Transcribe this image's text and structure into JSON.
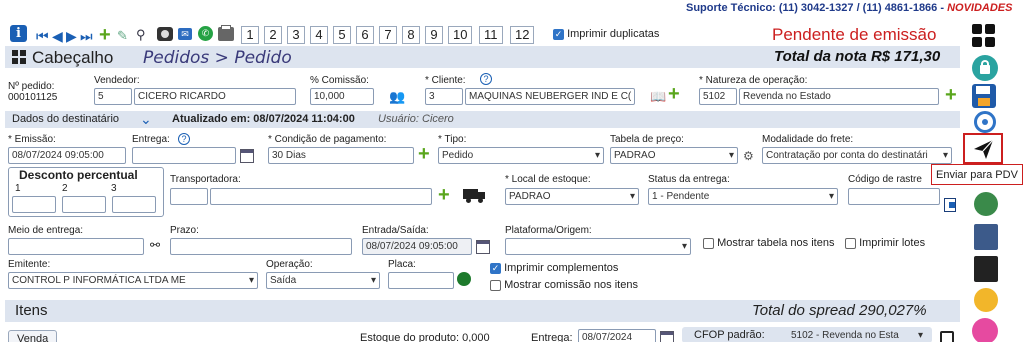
{
  "support": {
    "text": "Suporte Técnico: (11) 3042-1327 / (11) 4861-1866 - ",
    "novidades": "NOVIDADES"
  },
  "toolbar": {
    "pages": [
      "1",
      "2",
      "3",
      "4",
      "5",
      "6",
      "7",
      "8",
      "9",
      "10",
      "11",
      "12"
    ],
    "print_duplicates_label": "Imprimir duplicatas",
    "print_duplicates_checked": true
  },
  "status": "Pendente de emissão",
  "header": {
    "title": "Cabeçalho",
    "breadcrumb": "Pedidos > Pedido",
    "total": "Total da nota R$ 171,30"
  },
  "order": {
    "numero_label": "Nº pedido:",
    "numero_value": "000101125",
    "vendedor_label": "Vendedor:",
    "vendedor_code": "5",
    "vendedor_name": "CICERO RICARDO",
    "comissao_label": "% Comissão:",
    "comissao_value": "10,000",
    "cliente_label": "* Cliente:",
    "cliente_code": "3",
    "cliente_name": "MAQUINAS NEUBERGER IND E C(",
    "natureza_label": "* Natureza de operação:",
    "natureza_code": "5102",
    "natureza_name": "Revenda no Estado"
  },
  "destinatario": {
    "label": "Dados do destinatário",
    "updated": "Atualizado em: 08/07/2024 11:04:00",
    "user": "Usuário: Cicero"
  },
  "fields": {
    "emissao_label": "* Emissão:",
    "emissao_value": "08/07/2024 09:05:00",
    "entrega_label": "Entrega:",
    "entrega_value": "",
    "condicao_label": "* Condição de pagamento:",
    "condicao_value": "30 Dias",
    "tipo_label": "* Tipo:",
    "tipo_value": "Pedido",
    "tabela_label": "Tabela de preço:",
    "tabela_value": "PADRAO",
    "modalidade_label": "Modalidade do frete:",
    "modalidade_value": "Contratação por conta do destinatári",
    "desconto_title": "Desconto percentual",
    "desconto_cols": [
      "1",
      "2",
      "3"
    ],
    "transportadora_label": "Transportadora:",
    "local_label": "* Local de estoque:",
    "local_value": "PADRAO",
    "status_entrega_label": "Status da entrega:",
    "status_entrega_value": "1 - Pendente",
    "codigo_rastreio_label": "Código de rastre",
    "meio_label": "Meio de entrega:",
    "prazo_label": "Prazo:",
    "entrada_label": "Entrada/Saída:",
    "entrada_value": "08/07/2024 09:05:00",
    "plataforma_label": "Plataforma/Origem:",
    "mostrar_tabela_label": "Mostrar tabela nos itens",
    "imprimir_lotes_label": "Imprimir lotes",
    "emitente_label": "Emitente:",
    "emitente_value": "CONTROL P INFORMÁTICA LTDA ME",
    "operacao_label": "Operação:",
    "operacao_value": "Saída",
    "placa_label": "Placa:",
    "imprimir_complementos_label": "Imprimir complementos",
    "mostrar_comissao_label": "Mostrar comissão nos itens"
  },
  "itens": {
    "title": "Itens",
    "spread": "Total do spread 290,027%",
    "venda_button": "Venda",
    "estoque": "Estoque do produto: 0,000",
    "entrega_label": "Entrega:",
    "entrega_value": "08/07/2024",
    "cfop_label": "CFOP padrão:",
    "cfop_value": "5102 - Revenda no Esta"
  },
  "tooltip": "Enviar para PDV",
  "colors": {
    "accent": "#1a5fb4",
    "status_red": "#cc1f1f",
    "bar": "#dde4ef",
    "green": "#5aa61d"
  }
}
